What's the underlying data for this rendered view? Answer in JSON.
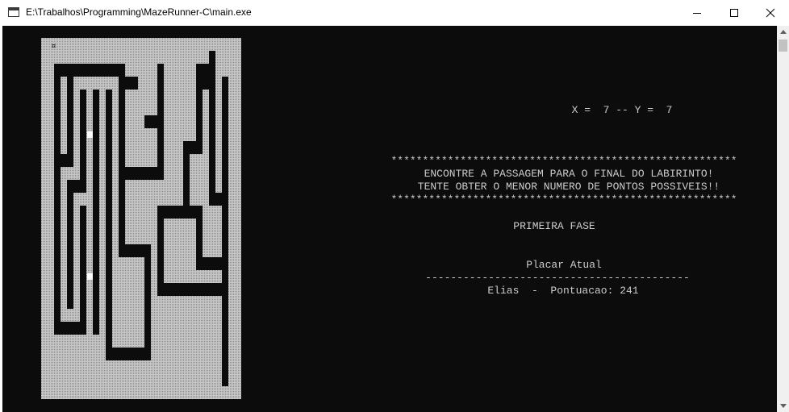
{
  "window": {
    "title": "E:\\Trabalhos\\Programming\\MazeRunner-C\\main.exe",
    "icon": "console-app-icon",
    "controls": [
      "minimize-icon",
      "maximize-icon",
      "close-icon"
    ]
  },
  "console": {
    "background": "#0c0c0c",
    "text_color": "#cccccc",
    "coords": "X =  7 -- Y =  7",
    "stars": "*******************************************************",
    "message_line1": "ENCONTRE A PASSAGEM PARA O FINAL DO LABIRINTO!",
    "message_line2": "TENTE OBTER O MENOR NUMERO DE PONTOS POSSIVEIS!!",
    "phase": "PRIMEIRA FASE",
    "scoreboard_title": "Placar Atual",
    "separator": "------------------------------------------",
    "score_line": "Elias  -  Pontuacao: 241"
  },
  "maze": {
    "floor_color": "#c8c8c8",
    "wall_color": "#0c0c0c",
    "player_char": "¤",
    "grid": [
      "................................",
      "..........................#.....",
      "..###########.....#.....###.....",
      "..#.#.......###...#.....###.#...",
      "..#.#.#.#.#.#.....#.....#.#.#...",
      "..#.#.#.#.#.#.....#.....#.#.#...",
      "..#.#.#.#.#.#...###.....#.#.#...",
      "..#.#.#.#.#.#.....#.....#.#.#...",
      "..#.#.#.#.#.#.....#...###.#.#...",
      "..###.#.#.#.#.....#...#...#.#...",
      "..#...#.#.#.#######...#...#.#...",
      "..#.###.#.#.#.........#...#.#...",
      "..#.#...#.#.#.........#...###...",
      "..#.#.#.#.#.#.....#######...#...",
      "..#.#.#.#.#.#.....#.....#...#...",
      "..#.#.#.#.#.#.....#.....#...#...",
      "..#.#.#.#.#.#####.#.....#...#...",
      "..#.#.#.#.#.....#.#.....#####...",
      "..#.#.#.#.#.....#.#.........#...",
      "..#.#.#.#.#.....#.###########...",
      "..#.#.#.#.#.....#...........#...",
      "..#...#.#.#.....#...........#...",
      "..#####.#.#.....#...........#...",
      "..........#.....#...........#...",
      "..........#######...........#...",
      "............................#...",
      "............................#...",
      "................................"
    ]
  }
}
